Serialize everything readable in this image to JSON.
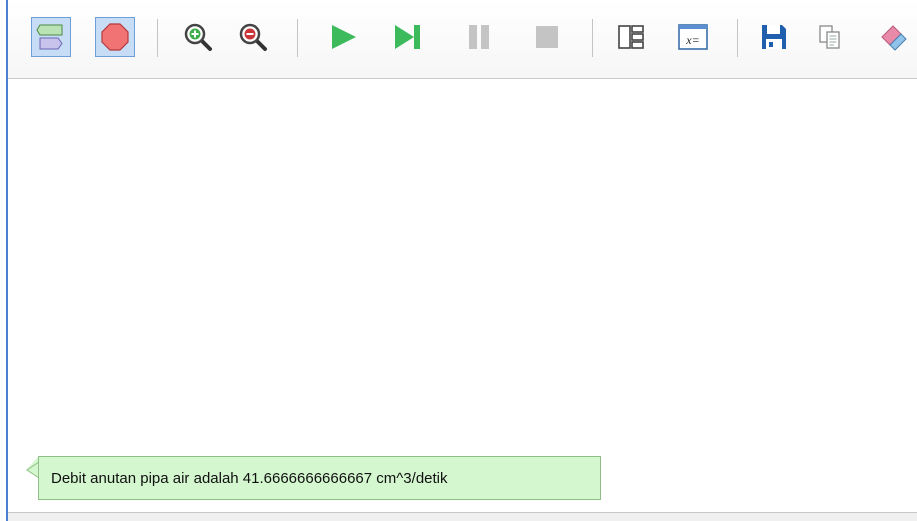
{
  "toolbar": {
    "buttons": [
      {
        "name": "flowchart-input-toggle",
        "icon": "input-output-shapes-icon",
        "toggled": true
      },
      {
        "name": "stop-toggle",
        "icon": "stop-octagon-icon",
        "toggled": true
      },
      {
        "name": "zoom-in",
        "icon": "zoom-in-icon",
        "toggled": false
      },
      {
        "name": "zoom-out",
        "icon": "zoom-out-icon",
        "toggled": false
      },
      {
        "name": "run",
        "icon": "play-icon",
        "toggled": false
      },
      {
        "name": "step",
        "icon": "step-forward-icon",
        "toggled": false
      },
      {
        "name": "pause",
        "icon": "pause-icon",
        "toggled": false
      },
      {
        "name": "stop",
        "icon": "stop-square-icon",
        "toggled": false
      },
      {
        "name": "layout",
        "icon": "layout-panels-icon",
        "toggled": false
      },
      {
        "name": "variables",
        "icon": "variables-window-icon",
        "toggled": false
      },
      {
        "name": "save",
        "icon": "floppy-disk-icon",
        "toggled": false
      },
      {
        "name": "copy",
        "icon": "copy-icon",
        "toggled": false
      },
      {
        "name": "erase",
        "icon": "eraser-icon",
        "toggled": false
      }
    ],
    "variables_icon_text": "x="
  },
  "output": {
    "message": "Debit anutan pipa air adalah 41.6666666666667 cm^3/detik"
  },
  "colors": {
    "accent_border": "#4a7fd0",
    "toggled_bg": "#c7ddf6",
    "output_bg": "#d4f7cf",
    "play_green": "#3dbb5c",
    "disabled_gray": "#c4c4c4"
  }
}
